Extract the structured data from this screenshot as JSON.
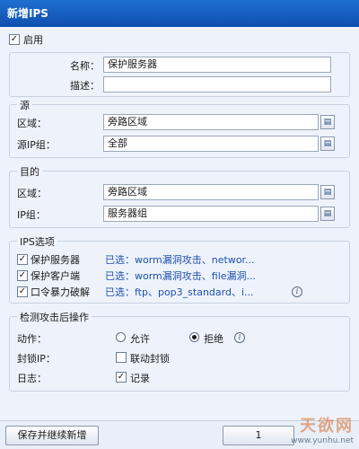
{
  "window": {
    "title": "新增IPS"
  },
  "enable": {
    "label": "启用",
    "checked": true
  },
  "basic": {
    "name_label": "名称：",
    "name_value": "保护服务器",
    "desc_label": "描述：",
    "desc_value": ""
  },
  "source": {
    "title": "源",
    "zone_label": "区域：",
    "zone_value": "旁路区域",
    "group_label": "源IP组：",
    "group_value": "全部"
  },
  "destination": {
    "title": "目的",
    "zone_label": "区域：",
    "zone_value": "旁路区域",
    "group_label": "IP组：",
    "group_value": "服务器组"
  },
  "ips": {
    "title": "IPS选项",
    "options": [
      {
        "label": "保护服务器",
        "checked": true,
        "selected": "已选：worm漏洞攻击、networ..."
      },
      {
        "label": "保护客户端",
        "checked": true,
        "selected": "已选：worm漏洞攻击、file漏洞..."
      },
      {
        "label": "口令暴力破解",
        "checked": true,
        "selected": "已选：ftp、pop3_standard、i..."
      }
    ]
  },
  "action": {
    "title": "检测攻击后操作",
    "action_label": "动作：",
    "allow_label": "允许",
    "deny_label": "拒绝",
    "selected": "deny",
    "block_label": "封锁IP：",
    "block_option_label": "联动封锁",
    "block_checked": false,
    "log_label": "日志：",
    "log_option_label": "记录",
    "log_checked": true
  },
  "footer": {
    "save_new_label": "保存并继续新增",
    "second_button_label": "1"
  },
  "watermark": {
    "brand": "天欲网",
    "url": "www.yunhu.net"
  }
}
